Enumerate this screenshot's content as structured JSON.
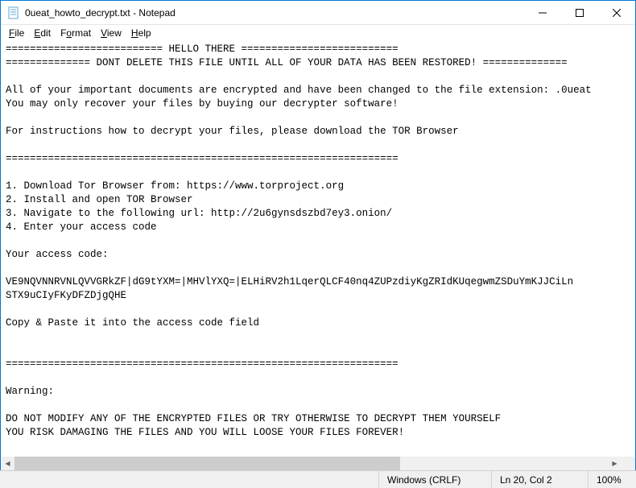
{
  "window": {
    "title": "0ueat_howto_decrypt.txt - Notepad"
  },
  "menu": {
    "file": "File",
    "edit": "Edit",
    "format": "Format",
    "view": "View",
    "help": "Help"
  },
  "content": {
    "text": "========================== HELLO THERE ==========================\n============== DONT DELETE THIS FILE UNTIL ALL OF YOUR DATA HAS BEEN RESTORED! ==============\n\nAll of your important documents are encrypted and have been changed to the file extension: .0ueat\nYou may only recover your files by buying our decrypter software!\n\nFor instructions how to decrypt your files, please download the TOR Browser\n\n=================================================================\n\n1. Download Tor Browser from: https://www.torproject.org\n2. Install and open TOR Browser\n3. Navigate to the following url: http://2u6gynsdszbd7ey3.onion/\n4. Enter your access code\n\nYour access code:\n\nVE9NQVNNRVNLQVVGRkZF|dG9tYXM=|MHVlYXQ=|ELHiRV2h1LqerQLCF40nq4ZUPzdiyKgZRIdKUqegwmZSDuYmKJJCiLn\nSTX9uCIyFKyDFZDjgQHE\n\nCopy & Paste it into the access code field\n\n\n=================================================================\n\nWarning:\n\nDO NOT MODIFY ANY OF THE ENCRYPTED FILES OR TRY OTHERWISE TO DECRYPT THEM YOURSELF\nYOU RISK DAMAGING THE FILES AND YOU WILL LOOSE YOUR FILES FOREVER!"
  },
  "status": {
    "encoding": "Windows (CRLF)",
    "position": "Ln 20, Col 2",
    "zoom": "100%"
  }
}
